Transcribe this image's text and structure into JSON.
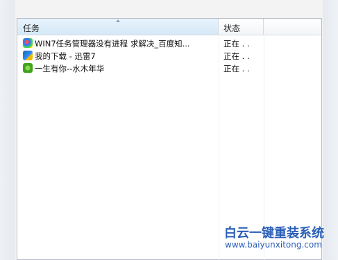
{
  "table": {
    "columns": [
      {
        "label": "任务",
        "sorted": true,
        "sort_direction": "ascending"
      },
      {
        "label": "状态"
      }
    ],
    "rows": [
      {
        "icon": "ie-icon",
        "title": "WIN7任务管理器没有进程 求解决_百度知...",
        "status": "正在 . ."
      },
      {
        "icon": "xunlei-icon",
        "title": "我的下载 - 迅雷7",
        "status": "正在 . ."
      },
      {
        "icon": "music-icon",
        "title": "一生有你--水木年华",
        "status": "正在 . ."
      }
    ]
  },
  "watermark": {
    "title": "白云一键重装系统",
    "url": "www.baiyunxitong.com"
  },
  "colors": {
    "header_selected_bg": "#d5e8f7",
    "watermark": "#2a5fb7",
    "border": "#b6bcc6"
  }
}
